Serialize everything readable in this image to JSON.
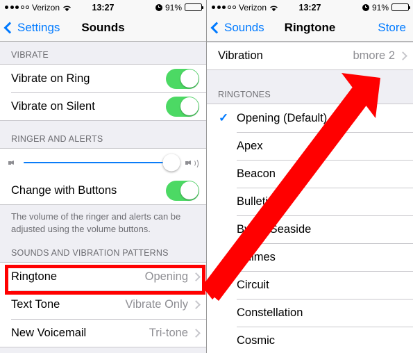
{
  "status_bar": {
    "carrier": "Verizon",
    "signal_filled": 3,
    "signal_empty": 2,
    "time": "13:27",
    "battery_percent": "91%",
    "battery_level": 91,
    "alarm_icon": "alarm-clock-icon",
    "wifi_icon": "wifi-icon"
  },
  "left_screen": {
    "nav": {
      "back_label": "Settings",
      "title": "Sounds"
    },
    "vibrate_section": {
      "header": "VIBRATE",
      "rows": [
        {
          "label": "Vibrate on Ring",
          "toggle": "on"
        },
        {
          "label": "Vibrate on Silent",
          "toggle": "on"
        }
      ]
    },
    "ringer_section": {
      "header": "RINGER AND ALERTS",
      "volume_percent": 95,
      "volume_icon_low": "speaker-low-icon",
      "volume_icon_high": "speaker-high-icon",
      "change_with_buttons": {
        "label": "Change with Buttons",
        "toggle": "on"
      },
      "footer": "The volume of the ringer and alerts can be adjusted using the volume buttons."
    },
    "sounds_section": {
      "header": "SOUNDS AND VIBRATION PATTERNS",
      "rows": [
        {
          "label": "Ringtone",
          "value": "Opening",
          "highlighted": true
        },
        {
          "label": "Text Tone",
          "value": "Vibrate Only",
          "highlighted": false
        },
        {
          "label": "New Voicemail",
          "value": "Tri-tone",
          "highlighted": false
        }
      ]
    }
  },
  "right_screen": {
    "nav": {
      "back_label": "Sounds",
      "title": "Ringtone",
      "action_label": "Store"
    },
    "vibration_row": {
      "label": "Vibration",
      "value": "bmore 2"
    },
    "ringtones_section": {
      "header": "RINGTONES",
      "items": [
        {
          "label": "Opening (Default)",
          "selected": true
        },
        {
          "label": "Apex",
          "selected": false
        },
        {
          "label": "Beacon",
          "selected": false
        },
        {
          "label": "Bulletin",
          "selected": false
        },
        {
          "label": "Byrne Seaside",
          "selected": false
        },
        {
          "label": "Chimes",
          "selected": false
        },
        {
          "label": "Circuit",
          "selected": false
        },
        {
          "label": "Constellation",
          "selected": false
        },
        {
          "label": "Cosmic",
          "selected": false
        }
      ],
      "checkmark_glyph": "✓"
    }
  },
  "annotations": {
    "highlight_box_target": "Ringtone",
    "arrow_color": "#ff0000",
    "box_color": "#ff0000"
  }
}
